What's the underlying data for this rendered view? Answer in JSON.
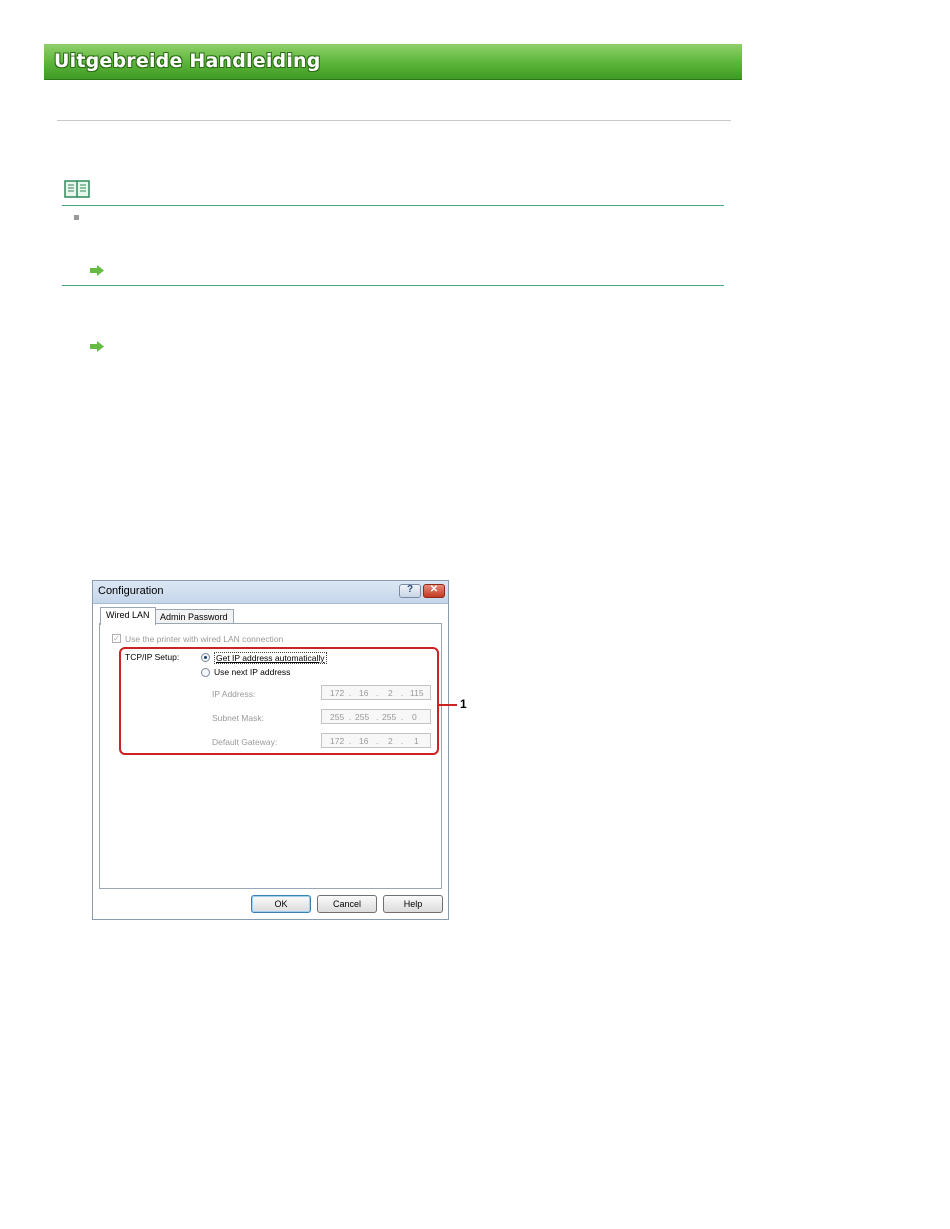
{
  "header": {
    "title": "Uitgebreide Handleiding"
  },
  "dialog": {
    "title": "Configuration",
    "tabs": [
      {
        "label": "Wired LAN",
        "active": true
      },
      {
        "label": "Admin Password",
        "active": false
      }
    ],
    "use_wired_lan_label": "Use the printer with wired LAN connection",
    "tcpip_label": "TCP/IP Setup:",
    "radio_auto": {
      "label": "Get IP address automatically",
      "selected": true
    },
    "radio_manual": {
      "label": "Use next IP address",
      "selected": false
    },
    "fields": [
      {
        "label": "IP Address:",
        "octets": [
          "172",
          "16",
          "2",
          "115"
        ]
      },
      {
        "label": "Subnet Mask:",
        "octets": [
          "255",
          "255",
          "255",
          "0"
        ]
      },
      {
        "label": "Default Gateway:",
        "octets": [
          "172",
          "16",
          "2",
          "1"
        ]
      }
    ],
    "buttons": {
      "ok": "OK",
      "cancel": "Cancel",
      "help": "Help"
    },
    "titlebar": {
      "help_glyph": "?",
      "close_glyph": "✕"
    }
  },
  "callout": {
    "number": "1",
    "color": "#cc2222"
  },
  "colors": {
    "header_green": "#5bb53a",
    "note_line": "#4aa57a",
    "arrow_green": "#66bb44"
  }
}
